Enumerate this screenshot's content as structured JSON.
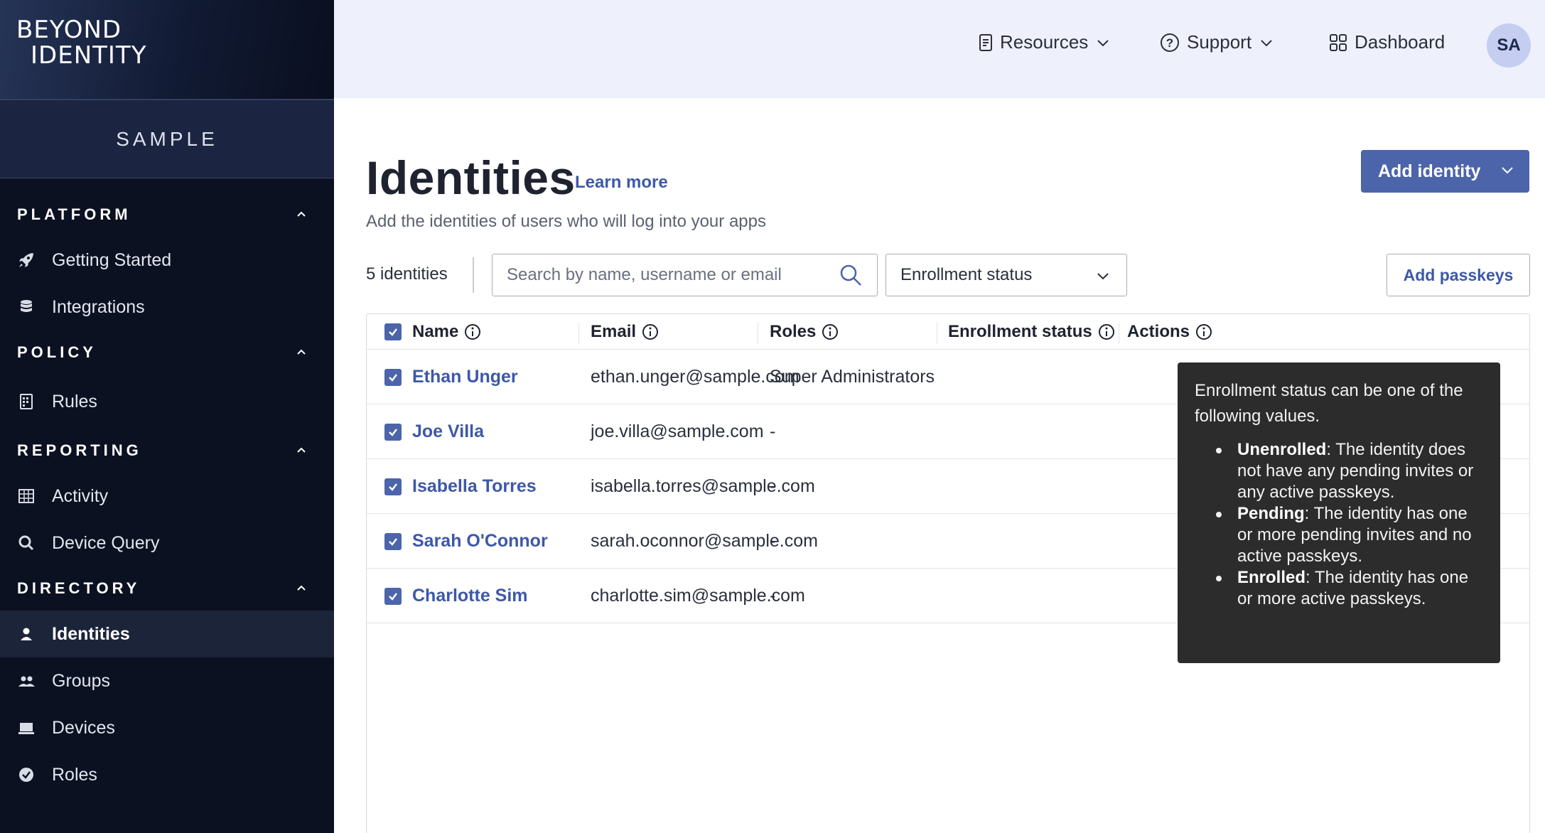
{
  "brand": {
    "logo_line1": "BEYOND",
    "logo_line2": "IDENTITY"
  },
  "tenant": "SAMPLE",
  "sidebar": {
    "sections": [
      {
        "title": "PLATFORM",
        "items": [
          {
            "label": "Getting Started",
            "icon": "rocket-icon"
          },
          {
            "label": "Integrations",
            "icon": "database-icon"
          }
        ]
      },
      {
        "title": "POLICY",
        "items": [
          {
            "label": "Rules",
            "icon": "rules-icon"
          }
        ]
      },
      {
        "title": "REPORTING",
        "items": [
          {
            "label": "Activity",
            "icon": "grid-icon"
          },
          {
            "label": "Device Query",
            "icon": "magnifier-icon"
          }
        ]
      },
      {
        "title": "DIRECTORY",
        "items": [
          {
            "label": "Identities",
            "icon": "person-icon",
            "active": true
          },
          {
            "label": "Groups",
            "icon": "group-icon"
          },
          {
            "label": "Devices",
            "icon": "laptop-icon"
          },
          {
            "label": "Roles",
            "icon": "badge-check-icon"
          }
        ]
      }
    ]
  },
  "topbar": {
    "resources": "Resources",
    "support": "Support",
    "dashboard": "Dashboard",
    "avatar_initials": "SA"
  },
  "page": {
    "title": "Identities",
    "learn_more": "Learn more",
    "subtitle": "Add the identities of users who will log into your apps",
    "add_identity": "Add identity",
    "count": "5 identities",
    "search_placeholder": "Search by name, username or email",
    "enrollment_filter": "Enrollment status",
    "add_passkeys": "Add passkeys"
  },
  "table": {
    "columns": [
      "Name",
      "Email",
      "Roles",
      "Enrollment status",
      "Actions"
    ],
    "rows": [
      {
        "name": "Ethan Unger",
        "email": "ethan.unger@sample.com",
        "roles": "Super Administrators"
      },
      {
        "name": "Joe Villa",
        "email": "joe.villa@sample.com",
        "roles": "-"
      },
      {
        "name": "Isabella Torres",
        "email": "isabella.torres@sample.com",
        "roles": "-"
      },
      {
        "name": "Sarah O'Connor",
        "email": "sarah.oconnor@sample.com",
        "roles": "-"
      },
      {
        "name": "Charlotte Sim",
        "email": "charlotte.sim@sample.com",
        "roles": "-"
      }
    ]
  },
  "tooltip": {
    "intro": "Enrollment status can be one of the following values.",
    "items": [
      {
        "term": "Unenrolled",
        "desc": ": The identity does not have any pending invites or any active passkeys."
      },
      {
        "term": "Pending",
        "desc": ": The identity has one or more pending invites and no active passkeys."
      },
      {
        "term": "Enrolled",
        "desc": ": The identity has one or more active passkeys."
      }
    ]
  },
  "colors": {
    "primary": "#4c64aa",
    "link": "#3d58a8",
    "sidebar_bg": "#0c1122",
    "topbar_bg": "#eef1fb",
    "tooltip_bg": "#2c2c2c"
  }
}
